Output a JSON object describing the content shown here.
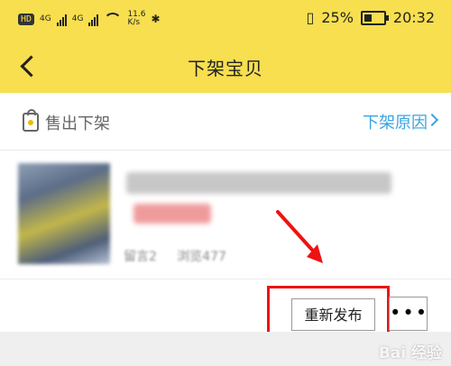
{
  "status_bar": {
    "network_label": "HD",
    "signal_1": "4G",
    "signal_2": "4G",
    "speed": "11.6",
    "speed_unit": "K/s",
    "battery": "25%",
    "time": "20:32"
  },
  "header": {
    "title": "下架宝贝"
  },
  "item_status": {
    "label": "售出下架",
    "reason_link": "下架原因"
  },
  "item": {
    "meta_left": "留言2",
    "meta_right": "浏览477"
  },
  "actions": {
    "republish": "重新发布",
    "more": "•••"
  },
  "watermark": "Bai 经验",
  "colors": {
    "header_bg": "#f7df4f",
    "link": "#3aa3e2",
    "annotation_red": "#ef1212"
  }
}
